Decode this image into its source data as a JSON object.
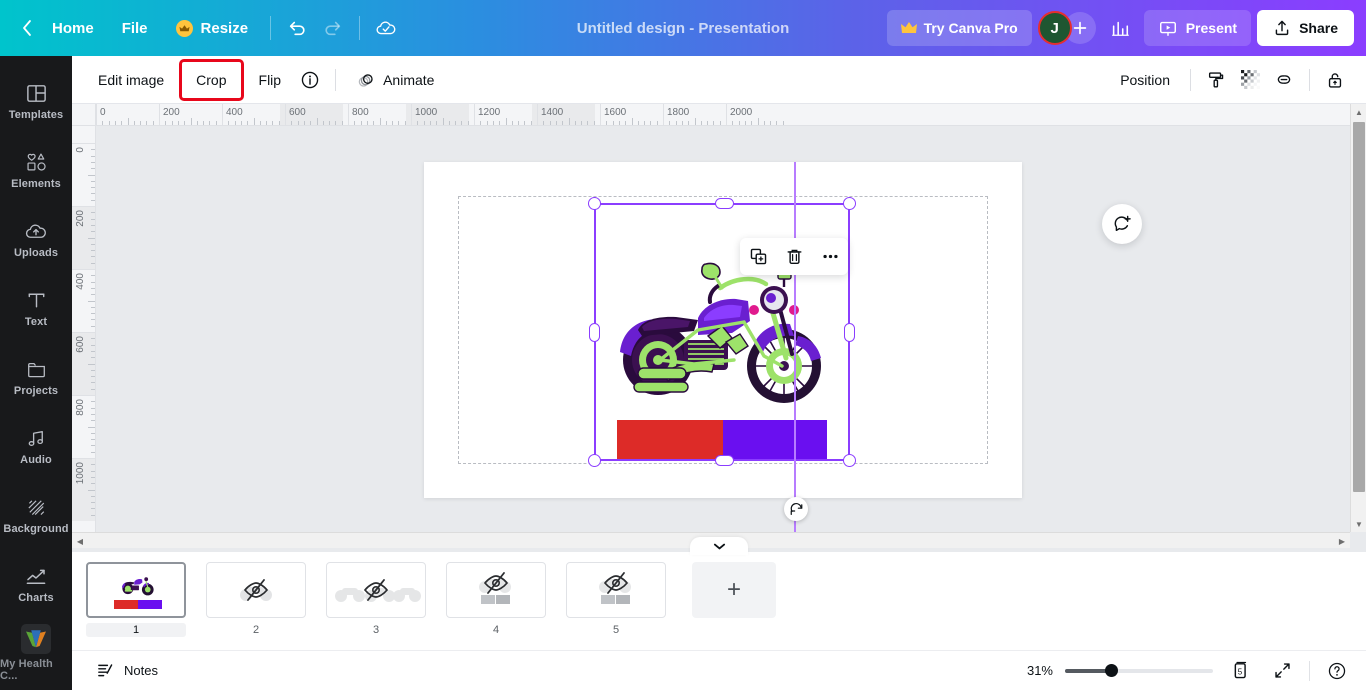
{
  "topbar": {
    "back_icon": "chevron-left-icon",
    "home_label": "Home",
    "file_label": "File",
    "resize_label": "Resize",
    "resize_icon": "crown-icon",
    "undo_icon": "undo-icon",
    "redo_icon": "redo-icon",
    "cloud_icon": "cloud-saved-icon",
    "title": "Untitled design - Presentation",
    "pro_label": "Try Canva Pro",
    "pro_icon": "crown-icon",
    "avatar_initial": "J",
    "add_person_icon": "plus-icon",
    "stats_icon": "bar-chart-icon",
    "present_label": "Present",
    "present_icon": "presentation-icon",
    "share_label": "Share",
    "share_icon": "share-upload-icon",
    "gradient_start": "#00c4cc",
    "gradient_end": "#8b3dff"
  },
  "toolbar": {
    "edit_image_label": "Edit image",
    "crop_label": "Crop",
    "flip_label": "Flip",
    "info_icon": "info-circle-icon",
    "animate_label": "Animate",
    "animate_icon": "animate-circles-icon",
    "position_label": "Position",
    "paint_icon": "paint-roller-icon",
    "transparency_icon": "transparency-checker-icon",
    "link_icon": "link-icon",
    "lock_icon": "lock-open-icon",
    "highlight_color": "#e8071b"
  },
  "sidebar": {
    "items": [
      {
        "label": "Templates",
        "icon": "templates-icon"
      },
      {
        "label": "Elements",
        "icon": "elements-icon"
      },
      {
        "label": "Uploads",
        "icon": "uploads-cloud-icon"
      },
      {
        "label": "Text",
        "icon": "text-t-icon"
      },
      {
        "label": "Projects",
        "icon": "folder-icon"
      },
      {
        "label": "Audio",
        "icon": "music-note-icon"
      },
      {
        "label": "Background",
        "icon": "background-hatch-icon"
      },
      {
        "label": "Charts",
        "icon": "line-chart-icon"
      }
    ],
    "brand_label": "My Health C...",
    "brand_icon": "my-health-logo-icon",
    "background": "#18191b"
  },
  "canvas": {
    "ruler_h_labels": [
      "0",
      "200",
      "400",
      "600",
      "800",
      "1000",
      "1200",
      "1400",
      "1600",
      "1800",
      "2000"
    ],
    "ruler_v_labels": [
      "0",
      "200",
      "400",
      "600",
      "800",
      "1000"
    ],
    "float_toolbar": {
      "duplicate_icon": "duplicate-icon",
      "delete_icon": "trash-icon",
      "more_icon": "more-horizontal-icon"
    },
    "rotate_icon": "rotate-icon",
    "comment_icon": "add-comment-icon",
    "selection_color": "#8b3dff",
    "element_bar_red": "#dd2b28",
    "element_bar_purple": "#6a0ff0",
    "image_alt": "purple-green-motorcycle"
  },
  "pages": {
    "thumbs": [
      {
        "num": "1",
        "state": "visible",
        "active": true
      },
      {
        "num": "2",
        "state": "hidden",
        "active": false
      },
      {
        "num": "3",
        "state": "hidden",
        "active": false
      },
      {
        "num": "4",
        "state": "hidden",
        "active": false
      },
      {
        "num": "5",
        "state": "hidden",
        "active": false
      }
    ],
    "add_label": "+",
    "collapse_icon": "chevron-down-icon"
  },
  "bottombar": {
    "notes_label": "Notes",
    "notes_icon": "notes-icon",
    "zoom_level": "31%",
    "page_count": "5",
    "pagecount_icon": "page-manager-icon",
    "fullscreen_icon": "expand-icon",
    "help_icon": "help-circle-icon"
  }
}
